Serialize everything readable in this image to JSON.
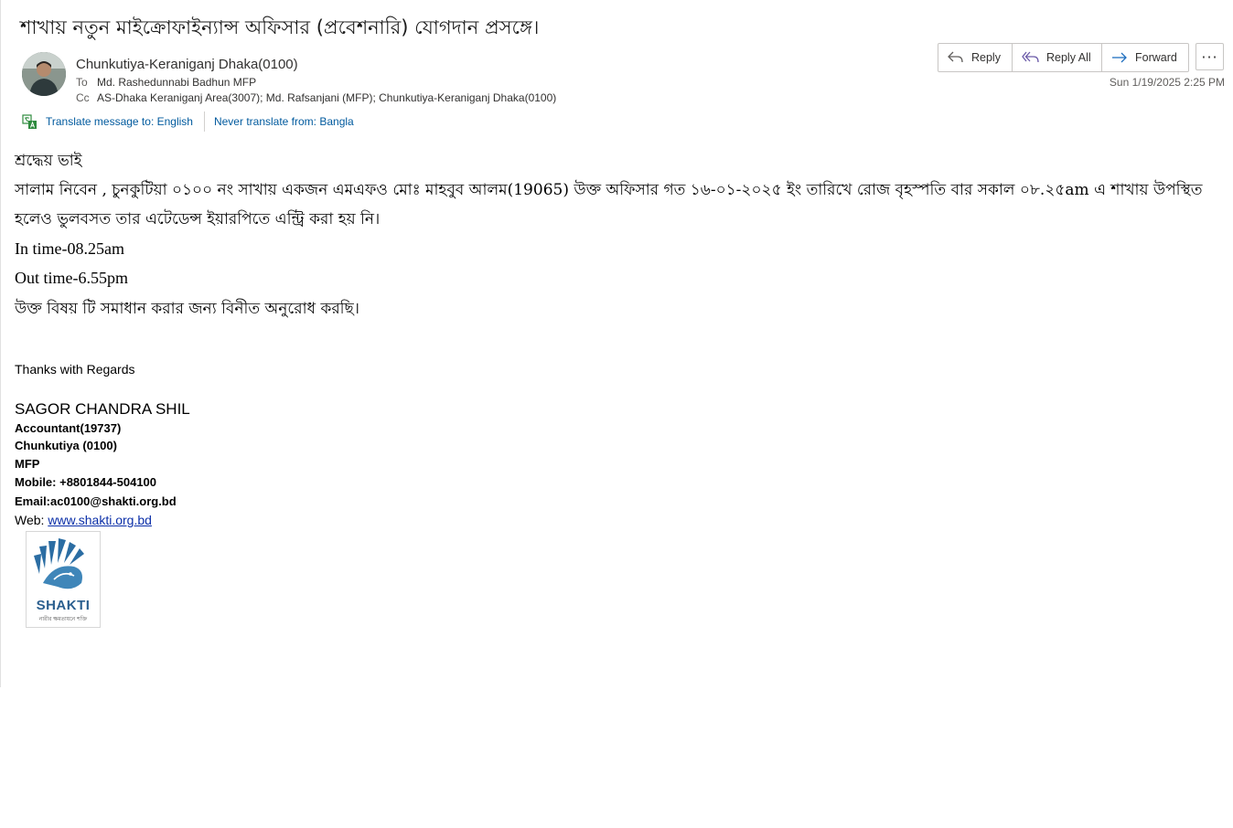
{
  "email": {
    "subject": "শাখায় নতুন মাইক্রোফাইন্যান্স অফিসার (প্রবেশনারি) যোগদান প্রসঙ্গে।",
    "sender": "Chunkutiya-Keraniganj Dhaka(0100)",
    "to_label": "To",
    "to": "Md. Rashedunnabi Badhun MFP",
    "cc_label": "Cc",
    "cc": "AS-Dhaka Keraniganj Area(3007); Md. Rafsanjani (MFP); Chunkutiya-Keraniganj Dhaka(0100)",
    "date": "Sun 1/19/2025 2:25 PM"
  },
  "actions": {
    "reply": "Reply",
    "reply_all": "Reply All",
    "forward": "Forward",
    "more": "···"
  },
  "translate": {
    "translate_to": "Translate message to: English",
    "never_translate": "Never translate from: Bangla"
  },
  "body": {
    "greeting": "শ্রদ্ধেয় ভাই",
    "line1": "সালাম নিবেন , চুনকুটিয়া ০১০০ নং সাখায় একজন এমএফও মোঃ মাহবুব আলম(19065) উক্ত অফিসার গত ১৬-০১-২০২৫ ইং তারিখে রোজ বৃহস্পতি বার সকাল ০৮.২৫am এ শাখায় উপস্থিত",
    "line2": "হলেও ভুলবসত তার এটেডেন্স ইয়ারপিতে এন্ট্রি করা হয় নি।",
    "in_time": "In time-08.25am",
    "out_time": "Out time-6.55pm",
    "request": "উক্ত বিষয় টি সমাধান করার জন্য বিনীত অনুরোধ করছি।"
  },
  "signature": {
    "regards": "Thanks with Regards",
    "name": "SAGOR CHANDRA SHIL",
    "title": "Accountant(19737)",
    "branch": "Chunkutiya (0100)",
    "org": "MFP",
    "mobile": "Mobile: +8801844-504100",
    "email": "Email:ac0100@shakti.org.bd",
    "web_label": "Web: ",
    "web_link": "www.shakti.org.bd",
    "logo_text": "SHAKTI",
    "logo_tagline": "নারীর ক্ষমতায়নে শক্তি"
  },
  "colors": {
    "link": "#005a9e",
    "web_link": "#0b2fa8",
    "logo_blue": "#2b5f8f"
  },
  "icons": {
    "reply": "reply-icon",
    "reply_all": "reply-all-icon",
    "forward": "forward-icon",
    "translate": "translate-icon",
    "more": "more-icon"
  }
}
